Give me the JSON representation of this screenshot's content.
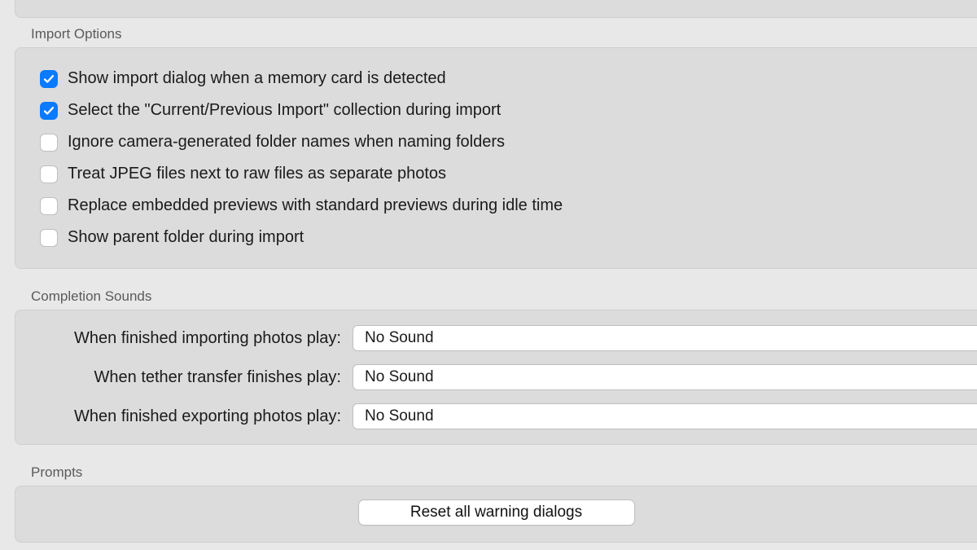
{
  "import_options": {
    "title": "Import Options",
    "items": [
      {
        "label": "Show import dialog when a memory card is detected",
        "checked": true
      },
      {
        "label": "Select the \"Current/Previous Import\" collection during import",
        "checked": true
      },
      {
        "label": "Ignore camera-generated folder names when naming folders",
        "checked": false
      },
      {
        "label": "Treat JPEG files next to raw files as separate photos",
        "checked": false
      },
      {
        "label": "Replace embedded previews with standard previews during idle time",
        "checked": false
      },
      {
        "label": "Show parent folder during import",
        "checked": false
      }
    ]
  },
  "completion_sounds": {
    "title": "Completion Sounds",
    "rows": [
      {
        "label": "When finished importing photos play:",
        "value": "No Sound"
      },
      {
        "label": "When tether transfer finishes play:",
        "value": "No Sound"
      },
      {
        "label": "When finished exporting photos play:",
        "value": "No Sound"
      }
    ]
  },
  "prompts": {
    "title": "Prompts",
    "reset_label": "Reset all warning dialogs"
  }
}
